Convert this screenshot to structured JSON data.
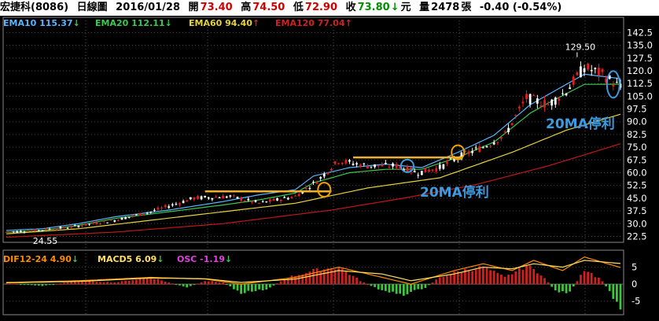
{
  "header": {
    "name": "宏捷科(8086)",
    "period": "日線圖",
    "date": "2016/01/28",
    "open_label": "開",
    "open": "73.40",
    "high_label": "高",
    "high": "74.50",
    "low_label": "低",
    "low": "72.90",
    "close_label": "收",
    "close": "73.80",
    "close_arrow": "↓",
    "currency": "元",
    "volume_label": "量",
    "volume": "2478",
    "volume_unit": "張",
    "change": "-0.40 (-0.54%)"
  },
  "colors": {
    "ema10": "#5ab4ff",
    "ema20": "#3cc850",
    "ema60": "#e6d23c",
    "ema120": "#c01818",
    "up": "#e02020",
    "down": "#ffffff",
    "macd_up": "#d02020",
    "macd_down": "#3cc83c",
    "resistance": "#f0b030",
    "circle_orange": "#f0a000",
    "circle_blue": "#3c9be0",
    "dif": "#ff8c00",
    "macd": "#ffe060"
  },
  "legend_main": [
    {
      "label": "EMA10 115.37",
      "arrow": "↓",
      "color": "#5ab4ff"
    },
    {
      "label": "EMA20 112.11",
      "arrow": "↓",
      "color": "#3cc850"
    },
    {
      "label": "EMA60 94.40",
      "arrow": "↑",
      "color": "#e6d23c"
    },
    {
      "label": "EMA120 77.04",
      "arrow": "↑",
      "color": "#c01818"
    }
  ],
  "legend_macd": [
    {
      "label": "DIF12-24 4.90",
      "arrow": "↓",
      "color": "#ff8c00"
    },
    {
      "label": "MACD5 6.09",
      "arrow": "↓",
      "color": "#ffe060"
    },
    {
      "label": "OSC -1.19",
      "arrow": "↓",
      "color": "#e040e0"
    }
  ],
  "annotations": {
    "note_1": "20MA停利",
    "note_2": "20MA停利",
    "high_label": "129.50",
    "low_label": "24.55"
  },
  "chart_data": [
    {
      "type": "candlestick",
      "ylim": [
        19,
        145
      ],
      "yticks": [
        "142.5",
        "135.0",
        "127.5",
        "120.0",
        "112.5",
        "105.0",
        "97.5",
        "90.0",
        "82.5",
        "75.0",
        "67.5",
        "60.0",
        "52.5",
        "45.0",
        "37.5",
        "30.0",
        "22.5"
      ],
      "ema_anchors": {
        "ema10": [
          [
            0,
            26
          ],
          [
            10,
            27
          ],
          [
            20,
            30
          ],
          [
            30,
            34
          ],
          [
            45,
            38
          ],
          [
            60,
            43
          ],
          [
            70,
            47
          ],
          [
            80,
            50
          ],
          [
            85,
            58
          ],
          [
            95,
            63
          ],
          [
            105,
            65
          ],
          [
            115,
            63
          ],
          [
            125,
            72
          ],
          [
            135,
            82
          ],
          [
            145,
            100
          ],
          [
            150,
            106
          ],
          [
            160,
            118
          ],
          [
            170,
            115.37
          ]
        ],
        "ema20": [
          [
            0,
            25
          ],
          [
            10,
            26
          ],
          [
            20,
            29
          ],
          [
            30,
            33
          ],
          [
            45,
            37
          ],
          [
            60,
            41
          ],
          [
            70,
            44
          ],
          [
            80,
            48
          ],
          [
            85,
            54
          ],
          [
            95,
            60
          ],
          [
            105,
            62
          ],
          [
            115,
            62
          ],
          [
            125,
            69
          ],
          [
            135,
            78
          ],
          [
            145,
            95
          ],
          [
            150,
            101
          ],
          [
            160,
            112
          ],
          [
            170,
            112.11
          ]
        ],
        "ema60": [
          [
            0,
            24
          ],
          [
            20,
            27
          ],
          [
            40,
            32
          ],
          [
            60,
            37
          ],
          [
            80,
            42
          ],
          [
            100,
            51
          ],
          [
            120,
            57
          ],
          [
            140,
            72
          ],
          [
            155,
            85
          ],
          [
            170,
            94.4
          ]
        ],
        "ema120": [
          [
            0,
            22
          ],
          [
            30,
            25
          ],
          [
            60,
            30
          ],
          [
            90,
            38
          ],
          [
            110,
            45
          ],
          [
            130,
            53
          ],
          [
            150,
            64
          ],
          [
            170,
            77.04
          ]
        ]
      },
      "price_anchors": [
        [
          0,
          25
        ],
        [
          8,
          26
        ],
        [
          18,
          28
        ],
        [
          30,
          32
        ],
        [
          40,
          37
        ],
        [
          52,
          45
        ],
        [
          62,
          46
        ],
        [
          70,
          42
        ],
        [
          80,
          46
        ],
        [
          86,
          55
        ],
        [
          92,
          67
        ],
        [
          100,
          64
        ],
        [
          108,
          64
        ],
        [
          114,
          60
        ],
        [
          120,
          63
        ],
        [
          126,
          70
        ],
        [
          132,
          75
        ],
        [
          138,
          82
        ],
        [
          144,
          104
        ],
        [
          150,
          100
        ],
        [
          155,
          108
        ],
        [
          160,
          122
        ],
        [
          165,
          118
        ],
        [
          170,
          110
        ]
      ],
      "resistance_lines": [
        {
          "y": 49,
          "from": 55,
          "to": 90
        },
        {
          "y": 69,
          "from": 96,
          "to": 126
        }
      ]
    },
    {
      "type": "macd",
      "ylim": [
        -9,
        10
      ],
      "yticks": [
        "5",
        "0",
        "-5"
      ],
      "osc_anchors": [
        [
          0,
          0.3
        ],
        [
          10,
          -0.5
        ],
        [
          20,
          1
        ],
        [
          30,
          0.5
        ],
        [
          40,
          2
        ],
        [
          50,
          -1
        ],
        [
          55,
          1
        ],
        [
          60,
          0.5
        ],
        [
          65,
          -2.5
        ],
        [
          72,
          -1.5
        ],
        [
          78,
          2
        ],
        [
          85,
          4
        ],
        [
          92,
          5
        ],
        [
          98,
          1
        ],
        [
          104,
          -2
        ],
        [
          110,
          -3
        ],
        [
          116,
          -1
        ],
        [
          120,
          2
        ],
        [
          126,
          4
        ],
        [
          132,
          5
        ],
        [
          138,
          2
        ],
        [
          144,
          5.5
        ],
        [
          148,
          3
        ],
        [
          152,
          -2
        ],
        [
          156,
          -2.5
        ],
        [
          160,
          4.5
        ],
        [
          165,
          1
        ],
        [
          170,
          -7
        ]
      ],
      "dif_anchors": [
        [
          0,
          0.5
        ],
        [
          20,
          1
        ],
        [
          40,
          2
        ],
        [
          55,
          1.5
        ],
        [
          65,
          0
        ],
        [
          80,
          2
        ],
        [
          92,
          5
        ],
        [
          104,
          2
        ],
        [
          112,
          0
        ],
        [
          124,
          4
        ],
        [
          132,
          6
        ],
        [
          140,
          4
        ],
        [
          146,
          7
        ],
        [
          154,
          4
        ],
        [
          160,
          8
        ],
        [
          170,
          4.9
        ]
      ],
      "macd_anchors": [
        [
          0,
          0.4
        ],
        [
          20,
          0.8
        ],
        [
          40,
          1.8
        ],
        [
          55,
          1.6
        ],
        [
          65,
          0.5
        ],
        [
          80,
          1.5
        ],
        [
          92,
          4
        ],
        [
          104,
          3
        ],
        [
          112,
          1
        ],
        [
          124,
          3
        ],
        [
          132,
          5
        ],
        [
          140,
          4.5
        ],
        [
          146,
          6
        ],
        [
          154,
          5
        ],
        [
          160,
          7
        ],
        [
          170,
          6.09
        ]
      ]
    }
  ]
}
